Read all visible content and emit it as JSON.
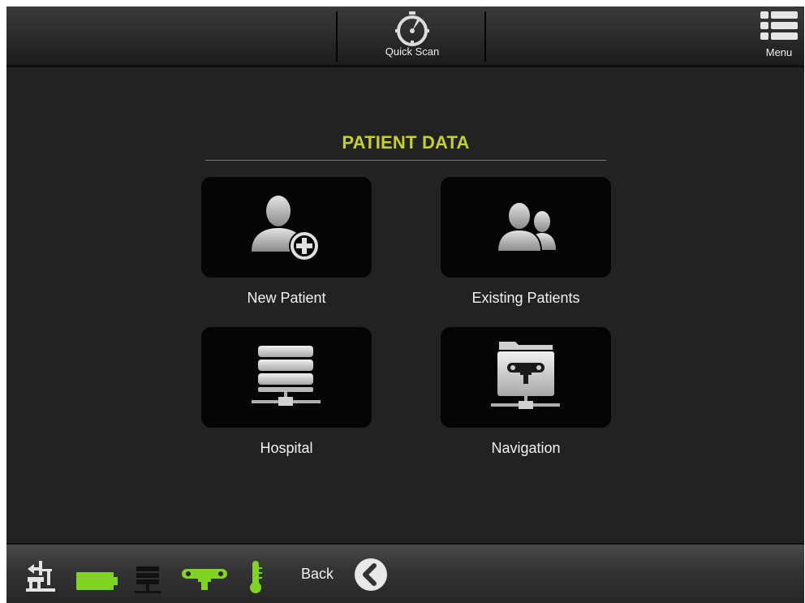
{
  "header": {
    "quick_scan_label": "Quick Scan",
    "menu_label": "Menu"
  },
  "main": {
    "title": "PATIENT DATA",
    "tiles": [
      {
        "label": "New Patient",
        "icon": "add-user-icon"
      },
      {
        "label": "Existing Patients",
        "icon": "users-icon"
      },
      {
        "label": "Hospital",
        "icon": "server-network-icon"
      },
      {
        "label": "Navigation",
        "icon": "navigation-folder-icon"
      }
    ]
  },
  "footer": {
    "back_label": "Back",
    "status_icons": [
      "device-icon",
      "battery-icon",
      "server-icon",
      "tracker-icon",
      "thermometer-icon"
    ]
  },
  "colors": {
    "accent": "#c6d127",
    "status_green": "#7fd321",
    "background": "#222222",
    "tile": "#050505"
  }
}
